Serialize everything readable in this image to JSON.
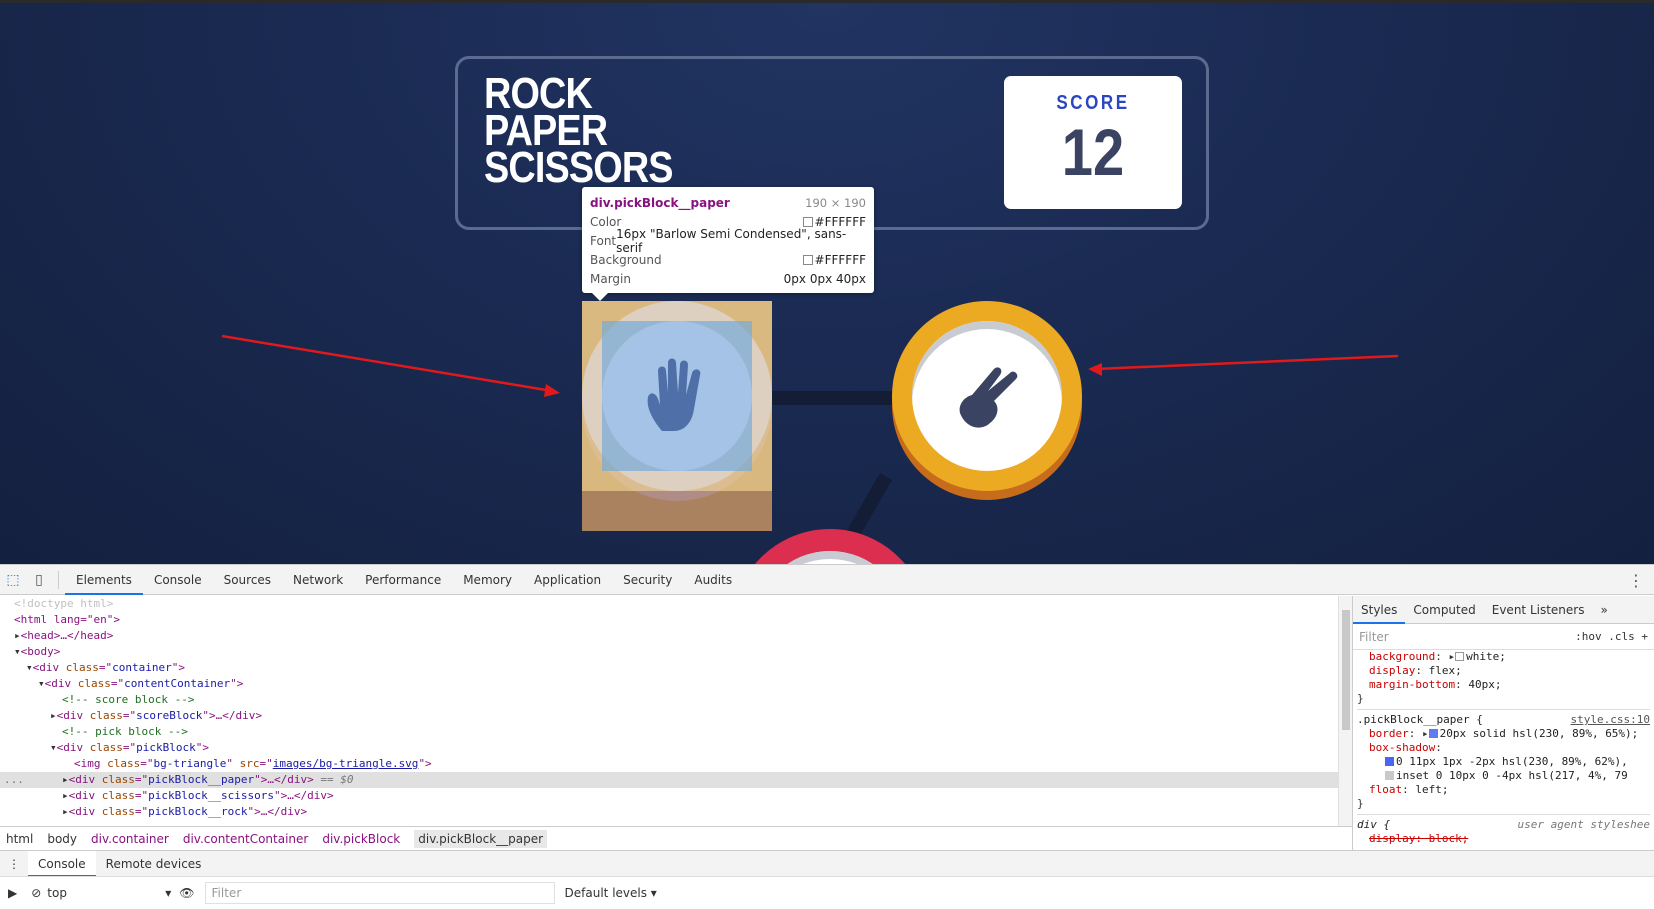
{
  "game": {
    "title_lines": [
      "ROCK",
      "PAPER",
      "SCISSORS"
    ],
    "score_label": "SCORE",
    "score_value": "12",
    "chips": [
      "paper",
      "scissors",
      "rock"
    ]
  },
  "tooltip": {
    "selector": "div.pickBlock__paper",
    "dimensions": "190 × 190",
    "rows": [
      {
        "key": "Color",
        "value": "#FFFFFF"
      },
      {
        "key": "Font",
        "value": "16px \"Barlow Semi Condensed\", sans-serif"
      },
      {
        "key": "Background",
        "value": "#FFFFFF"
      },
      {
        "key": "Margin",
        "value": "0px 0px 40px"
      }
    ]
  },
  "devtools": {
    "tabs": [
      "Elements",
      "Console",
      "Sources",
      "Network",
      "Performance",
      "Memory",
      "Application",
      "Security",
      "Audits"
    ],
    "active_tab": "Elements",
    "dom_lines": {
      "doctype": "<!doctype html>",
      "html": "<html lang=\"en\">",
      "head": "<head>…</head>",
      "body": "<body>",
      "container": "container",
      "contentContainer": "contentContainer",
      "comment_score": "<!-- score block -->",
      "scoreBlock": "scoreBlock",
      "comment_pick": "<!-- pick block -->",
      "pickBlock": "pickBlock",
      "img_class": "bg-triangle",
      "img_src": "images/bg-triangle.svg",
      "paper": "pickBlock__paper",
      "scissors": "pickBlock__scissors",
      "rock": "pickBlock__rock",
      "selected_marker": "== $0"
    },
    "breadcrumbs": [
      "html",
      "body",
      "div.container",
      "div.contentContainer",
      "div.pickBlock",
      "div.pickBlock__paper"
    ],
    "styles_tabs": [
      "Styles",
      "Computed",
      "Event Listeners"
    ],
    "filter_placeholder": "Filter",
    "filter_tools": ":hov  .cls  +",
    "css": {
      "rule1": [
        {
          "prop": "background",
          "value": "white;"
        },
        {
          "prop": "display",
          "value": "flex;"
        },
        {
          "prop": "margin-bottom",
          "value": "40px;"
        }
      ],
      "rule2_selector": ".pickBlock__paper {",
      "rule2_source": "style.css:10",
      "rule2": [
        {
          "prop": "border",
          "value": "20px solid hsl(230, 89%, 65%);"
        },
        {
          "prop": "box-shadow",
          "value": ""
        },
        {
          "prop": "",
          "value": "0 11px 1px -2px hsl(230, 89%, 62%),"
        },
        {
          "prop": "",
          "value": "inset 0 10px 0 -4px hsl(217, 4%, 79"
        },
        {
          "prop": "float",
          "value": "left;"
        }
      ],
      "rule3_selector": "div {",
      "rule3_source": "user agent styleshee",
      "rule3_prop": "display: block;"
    },
    "drawer_tabs": [
      "Console",
      "Remote devices"
    ],
    "console_context": "top",
    "console_filter": "Filter",
    "console_levels": "Default levels ▾"
  },
  "colors": {
    "paper": "#4865f4",
    "scissors": "#eca922",
    "rock": "#dc2e4e",
    "annotation_arrow": "#e01a1a"
  }
}
